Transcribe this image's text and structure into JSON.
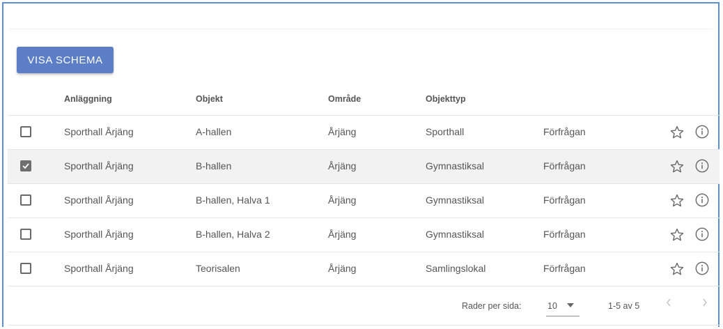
{
  "toolbar": {
    "show_schedule_label": "VISA SCHEMA"
  },
  "table": {
    "headers": {
      "facility": "Anläggning",
      "object": "Objekt",
      "area": "Område",
      "object_type": "Objekttyp"
    },
    "rows": [
      {
        "checked": false,
        "facility": "Sporthall Årjäng",
        "object": "A-hallen",
        "area": "Årjäng",
        "object_type": "Sporthall",
        "request": "Förfrågan"
      },
      {
        "checked": true,
        "facility": "Sporthall Årjäng",
        "object": "B-hallen",
        "area": "Årjäng",
        "object_type": "Gymnastiksal",
        "request": "Förfrågan"
      },
      {
        "checked": false,
        "facility": "Sporthall Årjäng",
        "object": "B-hallen, Halva 1",
        "area": "Årjäng",
        "object_type": "Gymnastiksal",
        "request": "Förfrågan"
      },
      {
        "checked": false,
        "facility": "Sporthall Årjäng",
        "object": "B-hallen, Halva 2",
        "area": "Årjäng",
        "object_type": "Gymnastiksal",
        "request": "Förfrågan"
      },
      {
        "checked": false,
        "facility": "Sporthall Årjäng",
        "object": "Teorisalen",
        "area": "Årjäng",
        "object_type": "Samlingslokal",
        "request": "Förfrågan"
      }
    ]
  },
  "pagination": {
    "rows_per_page_label": "Rader per sida:",
    "rows_per_page_value": "10",
    "range_label": "1-5 av 5"
  },
  "icons": {
    "star": "star-outline-icon",
    "info": "info-circle-icon",
    "checkbox_checked": "checkmark-icon",
    "caret": "caret-down-icon",
    "prev": "chevron-left-icon",
    "next": "chevron-right-icon"
  },
  "colors": {
    "accent": "#5b7ec7",
    "frame": "#5b8fd6",
    "selected_row": "#f2f2f2"
  }
}
